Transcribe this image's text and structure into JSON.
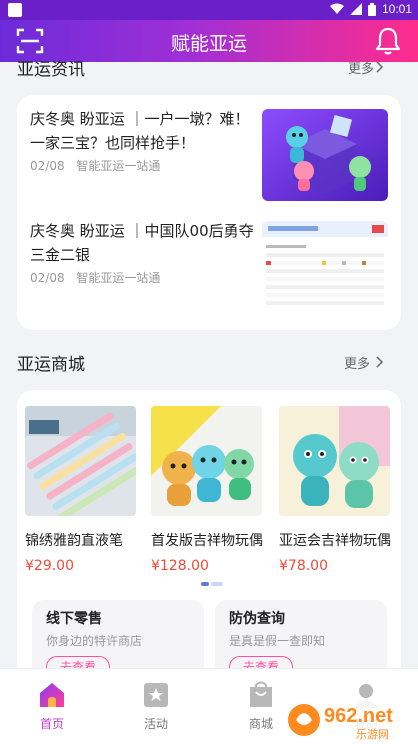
{
  "status_bar": {
    "time": "10:01"
  },
  "header": {
    "title": "赋能亚运"
  },
  "news_section": {
    "title": "亚运资讯",
    "more": "更多",
    "items": [
      {
        "title": "庆冬奥 盼亚运 ｜一户一墩？难！一家三宝？也同样抢手！",
        "date": "02/08",
        "source": "智能亚运一站通"
      },
      {
        "title": "庆冬奥 盼亚运 ｜中国队00后勇夺三金二银",
        "date": "02/08",
        "source": "智能亚运一站通"
      }
    ]
  },
  "mall_section": {
    "title": "亚运商城",
    "more": "更多",
    "products": [
      {
        "name": "锦绣雅韵直液笔",
        "price": "¥29.00"
      },
      {
        "name": "首发版吉祥物玩偶",
        "price": "¥128.00"
      },
      {
        "name": "亚运会吉祥物玩偶",
        "price": "¥78.00"
      }
    ],
    "sub_cards": [
      {
        "title": "线下零售",
        "desc": "你身边的特许商店",
        "button": "去查看"
      },
      {
        "title": "防伪查询",
        "desc": "是真是假一查即知",
        "button": "去查看"
      }
    ]
  },
  "tabbar": {
    "items": [
      {
        "label": "首页",
        "icon": "home-icon",
        "active": true
      },
      {
        "label": "活动",
        "icon": "activity-icon",
        "active": false
      },
      {
        "label": "商城",
        "icon": "mall-icon",
        "active": false
      },
      {
        "label": "我的",
        "icon": "profile-icon",
        "active": false
      }
    ]
  },
  "watermark": {
    "text": "962.net",
    "sub": "乐游网"
  },
  "colors": {
    "accent": "#c23fd0",
    "price": "#f04a3a",
    "header_start": "#6c2bd9",
    "header_end": "#ff2c8c"
  }
}
